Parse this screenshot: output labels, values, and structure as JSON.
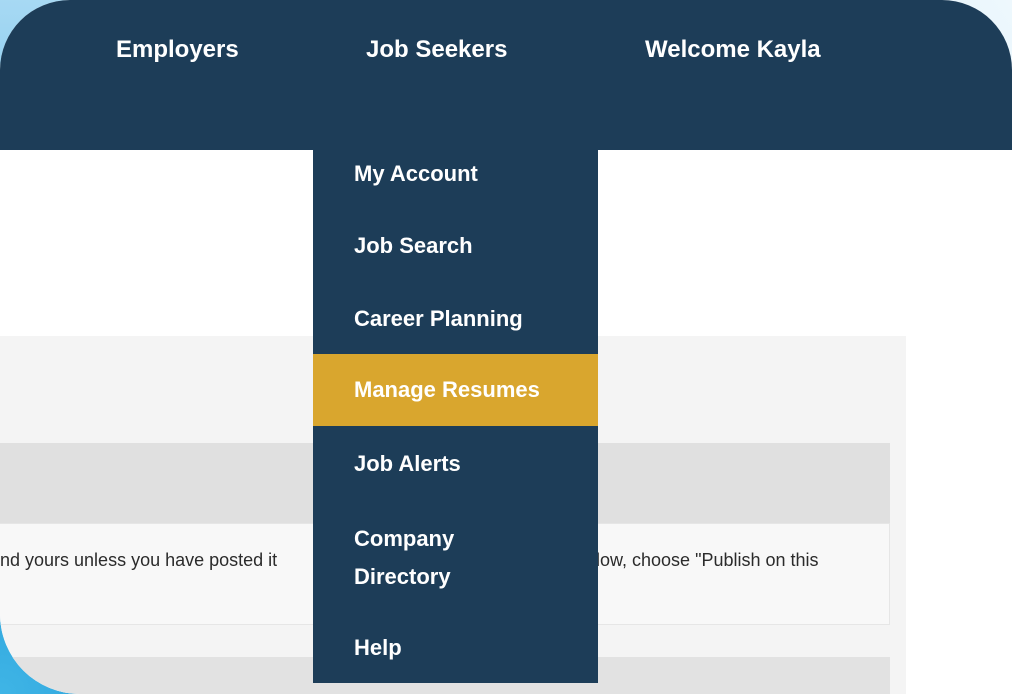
{
  "colors": {
    "navy": "#1d3d58",
    "accent_gold": "#d9a62e",
    "panel_gray": "#f4f4f4",
    "header_gray": "#e0e0e0"
  },
  "nav": {
    "employers": "Employers",
    "job_seekers": "Job Seekers",
    "welcome": "Welcome Kayla"
  },
  "dropdown": {
    "items": [
      {
        "label": "My Account"
      },
      {
        "label": "Job Search"
      },
      {
        "label": "Career Planning"
      },
      {
        "label": "Manage Resumes",
        "active": true
      },
      {
        "label": "Job Alerts"
      },
      {
        "label": "Company\nDirectory"
      },
      {
        "label": "Help"
      }
    ]
  },
  "content": {
    "notice_left": "nd yours unless you have posted it",
    "notice_right": "elow, choose \"Publish on this"
  }
}
